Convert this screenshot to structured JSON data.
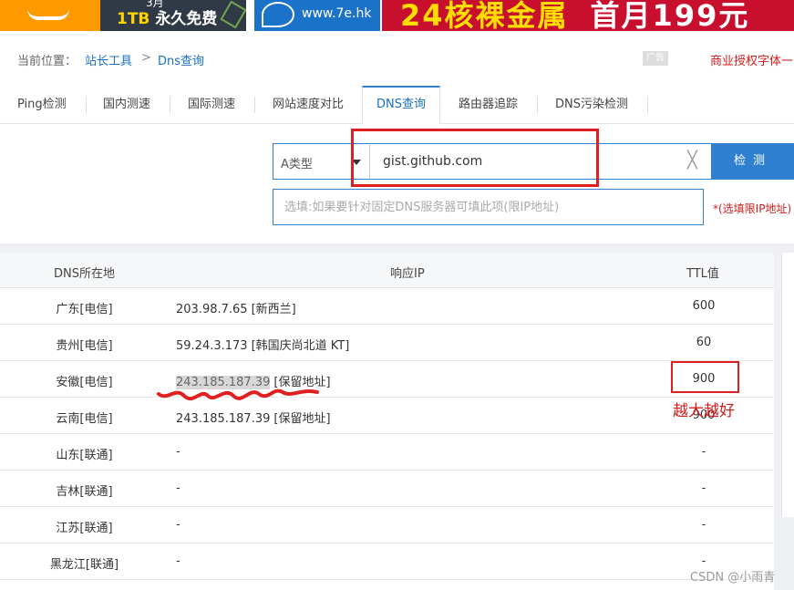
{
  "banners": {
    "b1_small": "3月",
    "b1_highlight": "1TB",
    "b1_text": "永久免费",
    "b2_site": "www.7e.hk",
    "b3_text": "24核裸金属",
    "b3_price": "首月199元"
  },
  "breadcrumb": {
    "label": "当前位置：",
    "link1": "站长工具",
    "sep": ">",
    "link2": "Dns查询",
    "ad": "广告",
    "right": "商业授权字体一"
  },
  "tabs": [
    {
      "label": "Ping检测"
    },
    {
      "label": "国内测速"
    },
    {
      "label": "国际测速"
    },
    {
      "label": "网站速度对比"
    },
    {
      "label": "DNS查询"
    },
    {
      "label": "路由器追踪"
    },
    {
      "label": "DNS污染检测"
    }
  ],
  "query": {
    "type_value": "A类型",
    "domain_value": "gist.github.com",
    "clear_glyph": "╳",
    "button_label": "检测",
    "server_placeholder": "选填:如果要针对固定DNS服务器可填此项(限IP地址)",
    "hint": "*(选填限IP地址)"
  },
  "table": {
    "headers": {
      "loc": "DNS所在地",
      "ip": "响应IP",
      "ttl": "TTL值"
    },
    "rows": [
      {
        "loc": "广东[电信]",
        "ip": "203.98.7.65",
        "tag": "[新西兰]",
        "ttl": "600"
      },
      {
        "loc": "贵州[电信]",
        "ip": "59.24.3.173",
        "tag": "[韩国庆尚北道 KT]",
        "ttl": "60"
      },
      {
        "loc": "安徽[电信]",
        "ip": "243.185.187.39",
        "tag": "[保留地址]",
        "ttl": "900"
      },
      {
        "loc": "云南[电信]",
        "ip": "243.185.187.39",
        "tag": "[保留地址]",
        "ttl": "900"
      },
      {
        "loc": "山东[联通]",
        "ip": "-",
        "tag": "",
        "ttl": "-"
      },
      {
        "loc": "吉林[联通]",
        "ip": "-",
        "tag": "",
        "ttl": "-"
      },
      {
        "loc": "江苏[联通]",
        "ip": "-",
        "tag": "",
        "ttl": "-"
      },
      {
        "loc": "黑龙江[联通]",
        "ip": "-",
        "tag": "",
        "ttl": "-"
      }
    ]
  },
  "annotation": {
    "note": "越大越好",
    "color": "#e02020"
  },
  "watermark": "CSDN @小雨青"
}
